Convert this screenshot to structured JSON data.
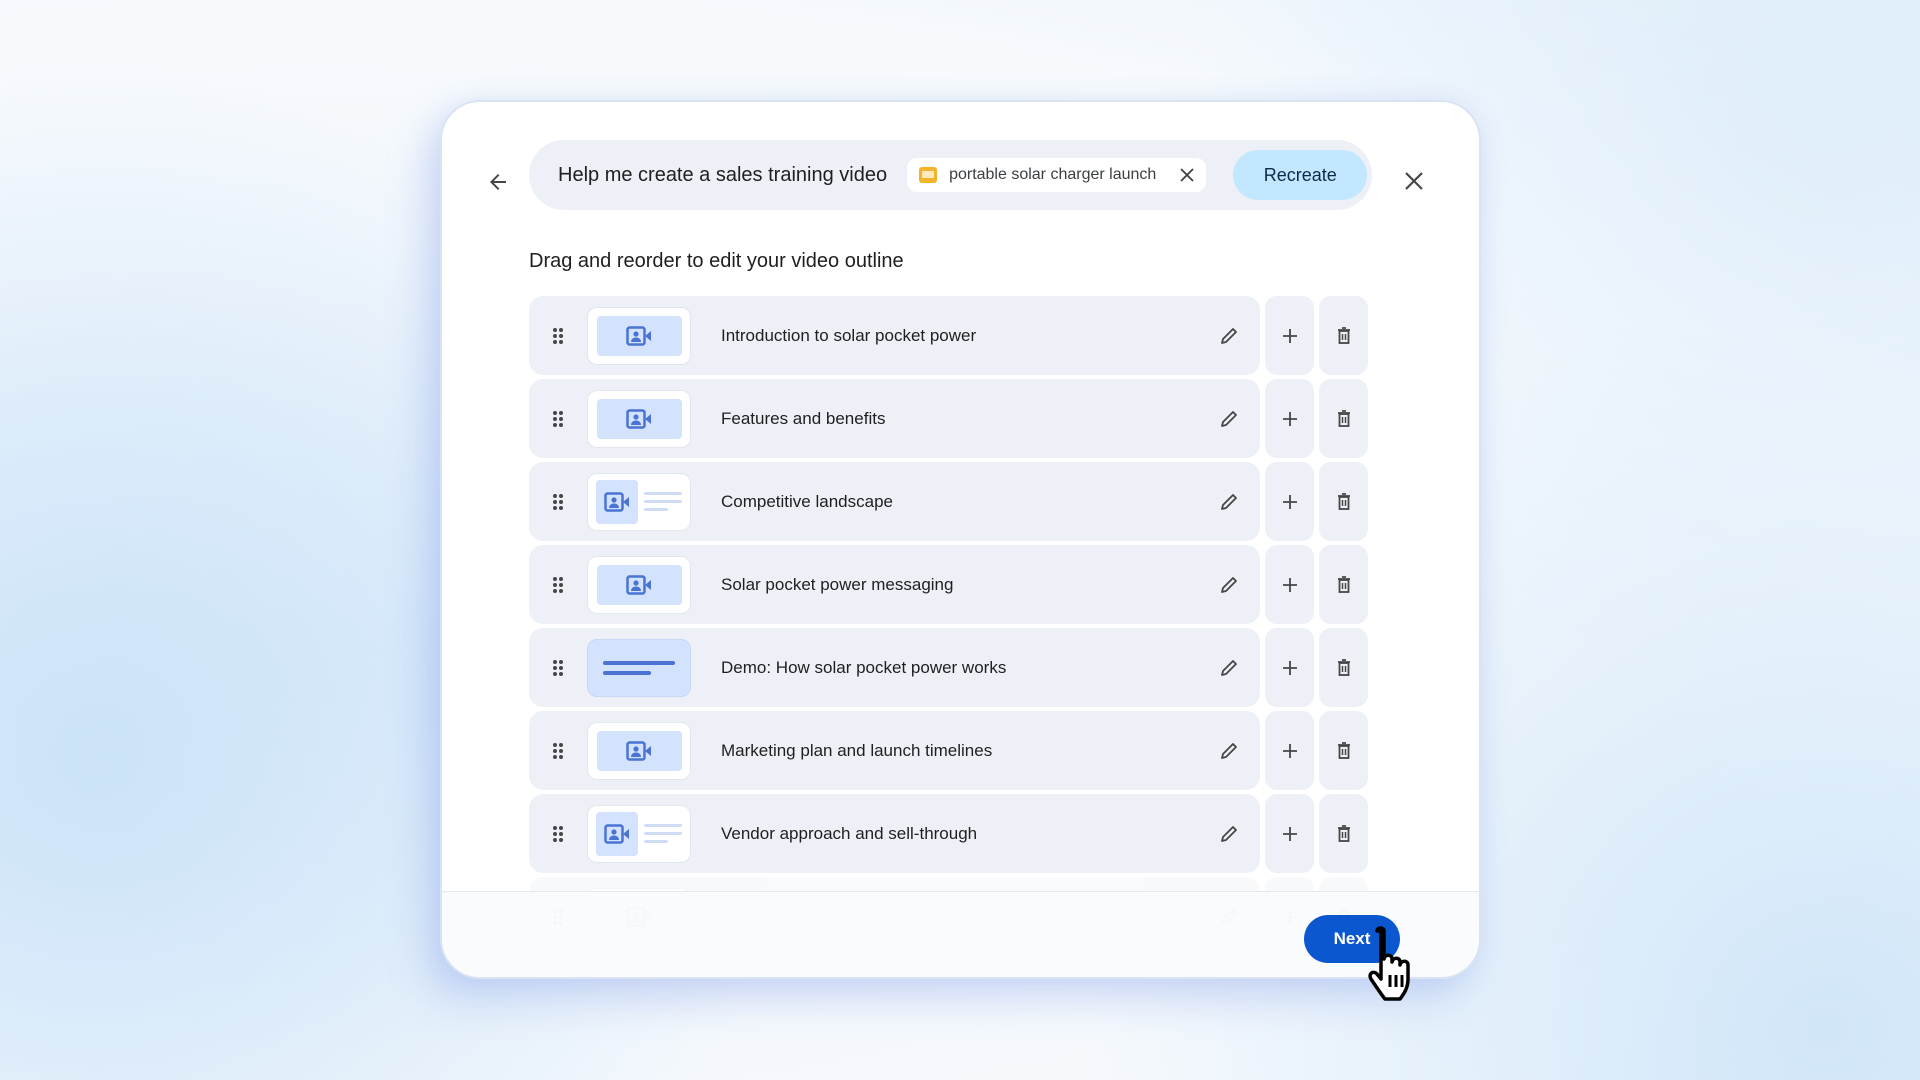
{
  "header": {
    "back_icon": "arrow-left-icon",
    "prompt": "Help me create a sales training video",
    "attachment": {
      "icon": "slides-icon",
      "label": "portable solar charger launch",
      "remove_icon": "close-icon"
    },
    "recreate_label": "Recreate",
    "close_icon": "close-icon"
  },
  "outline": {
    "heading": "Drag and reorder to edit your video outline",
    "items": [
      {
        "title": "Introduction to solar pocket power",
        "thumbnail": "video"
      },
      {
        "title": "Features and benefits",
        "thumbnail": "video"
      },
      {
        "title": "Competitive landscape",
        "thumbnail": "video-with-text"
      },
      {
        "title": "Solar pocket power messaging",
        "thumbnail": "video"
      },
      {
        "title": "Demo: How solar pocket power works",
        "thumbnail": "text"
      },
      {
        "title": "Marketing plan and launch timelines",
        "thumbnail": "video"
      },
      {
        "title": "Vendor approach and sell-through",
        "thumbnail": "video-with-text"
      }
    ],
    "row_icons": {
      "drag": "drag-handle-icon",
      "edit": "pencil-icon",
      "add": "plus-icon",
      "delete": "trash-icon"
    }
  },
  "footer": {
    "next_label": "Next"
  },
  "colors": {
    "primary": "#0b57d0",
    "recreate_bg": "#c2e7ff",
    "row_bg": "#edf0f6",
    "thumb_accent": "#d3e3fd",
    "icon_accent": "#4a73d4",
    "chip_icon": "#f2b42c"
  }
}
